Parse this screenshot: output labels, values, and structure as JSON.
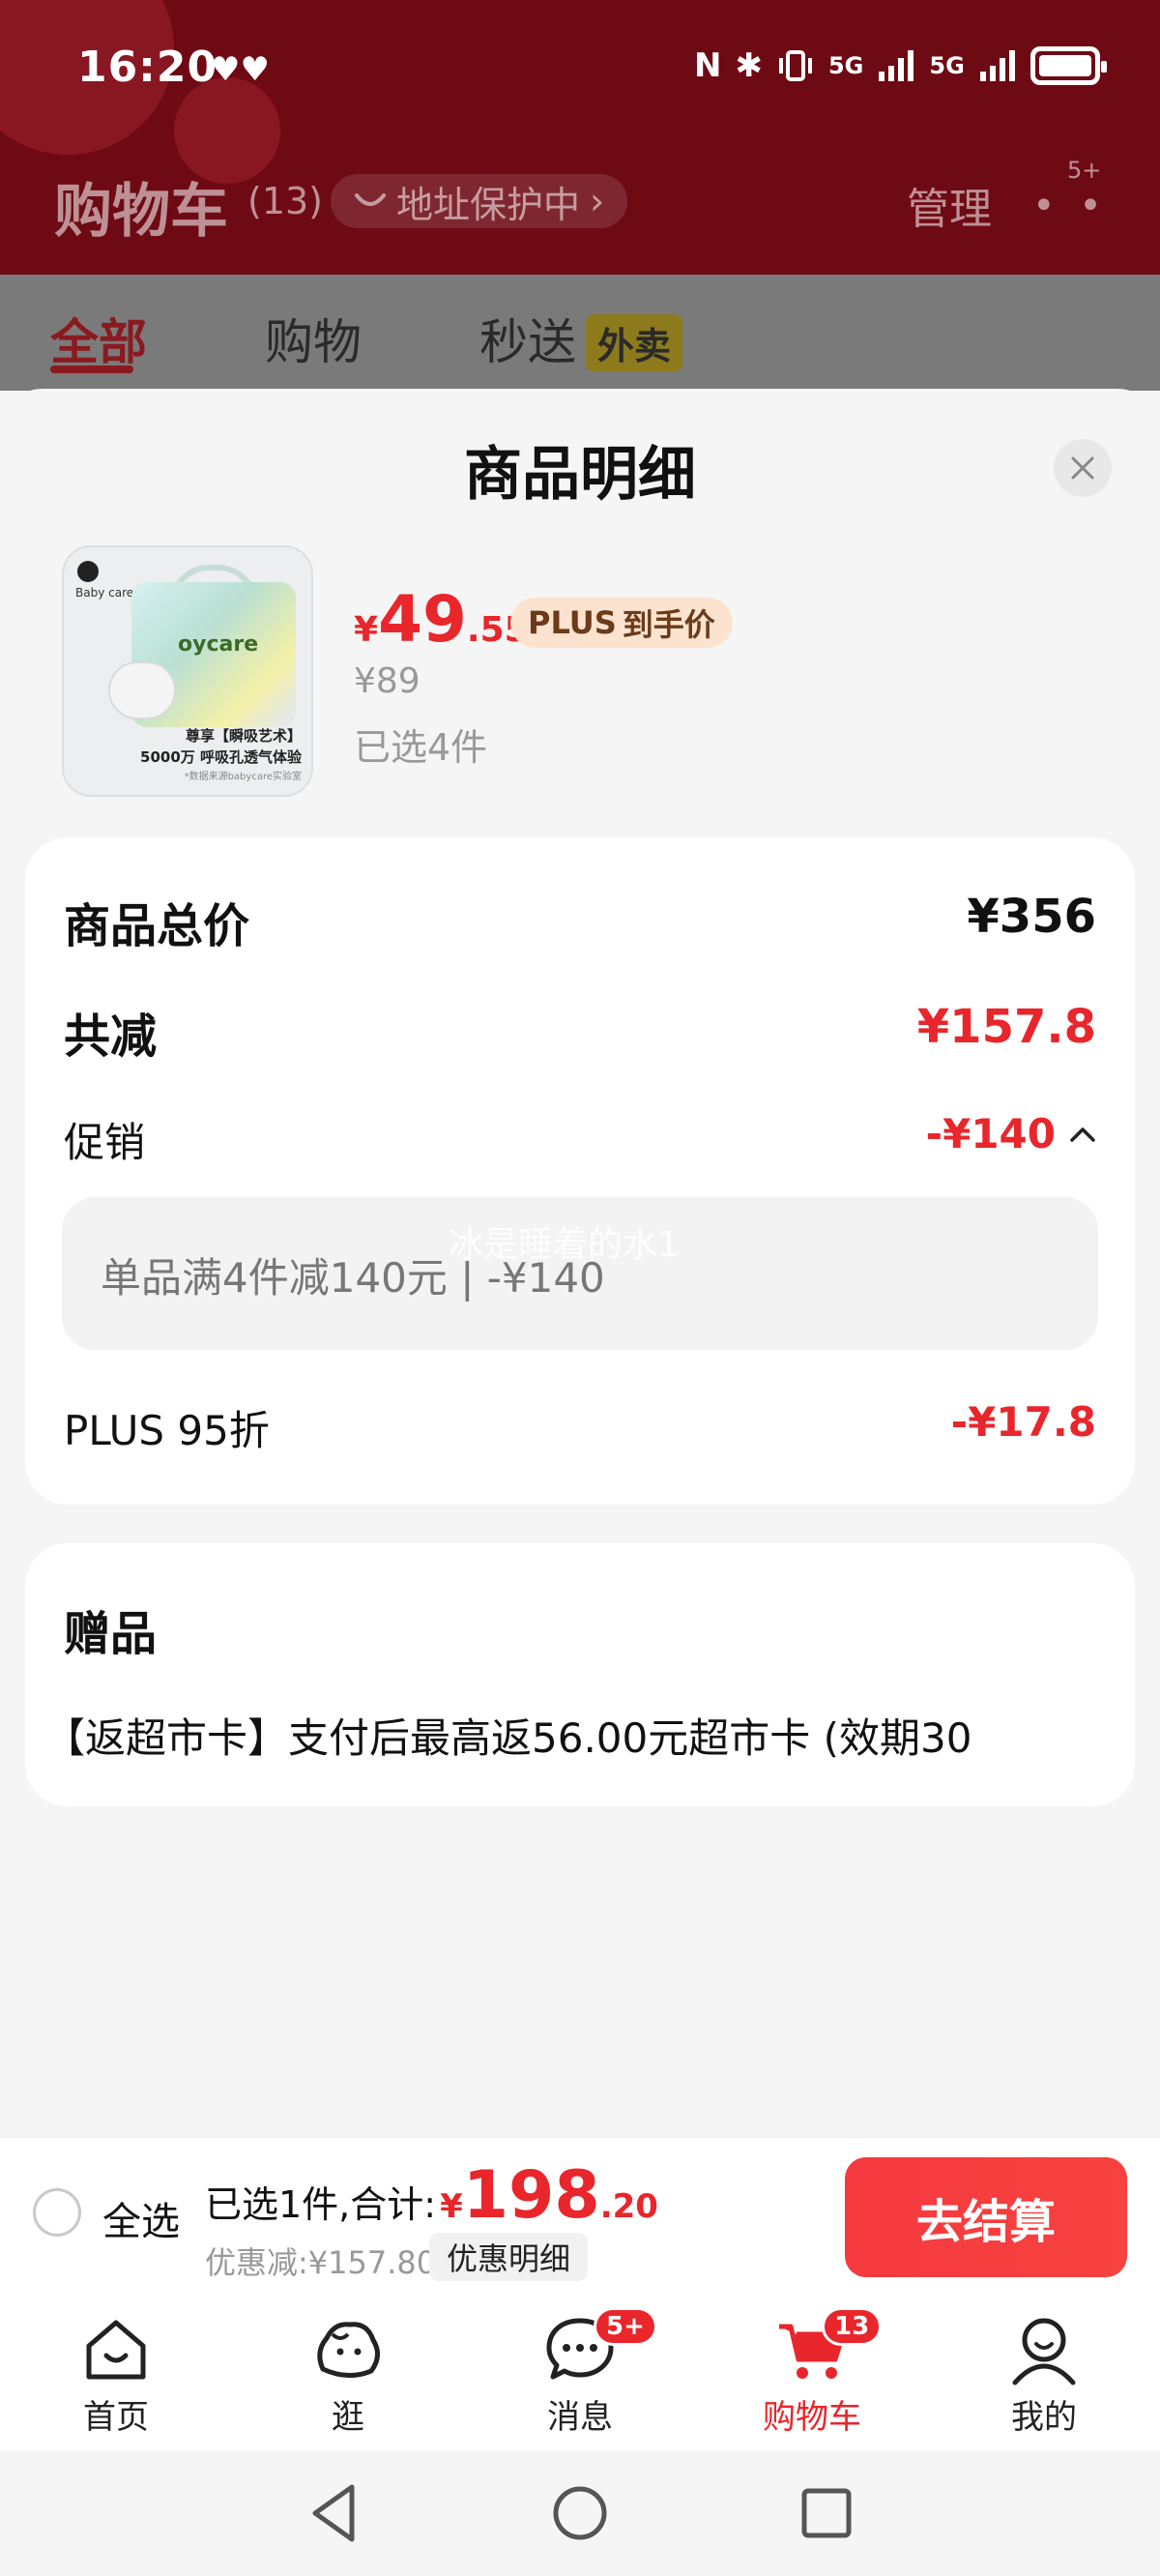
{
  "status_bar": {
    "time": "16:20",
    "notif_glyphs": "♥♥",
    "nfc": "N",
    "bt": "✱",
    "signal1": "5G",
    "signal2": "5G"
  },
  "header": {
    "title": "购物车",
    "count": "(13)",
    "address_label": "地址保护中",
    "manage_label": "管理",
    "more_badge": "5+"
  },
  "tabs": [
    {
      "label": "全部"
    },
    {
      "label": "购物"
    },
    {
      "label": "秒送",
      "tag": "外卖"
    }
  ],
  "sheet": {
    "title": "商品明细",
    "product": {
      "brand": "Baby care",
      "bag_text": "oycare",
      "caption1": "尊享【瞬吸艺术】",
      "caption2": "5000万 呼吸孔透气体验",
      "caption3": "*数据来源babycare实验室",
      "price_symbol": "¥",
      "price_int": "49",
      "price_dec": ".55",
      "plus_label": "PLUS",
      "plus_suffix": "到手价",
      "original_price": "¥89",
      "selected_qty": "已选4件"
    },
    "summary": {
      "total_label": "商品总价",
      "total_value": "¥356",
      "reduce_label": "共减",
      "reduce_value": "¥157.8",
      "promo_label": "促销",
      "promo_value": "-¥140",
      "promo_detail": "单品满4件减140元 | -¥140",
      "watermark": "冰是睡着的水1",
      "plus_discount_label": "PLUS 95折",
      "plus_discount_value": "-¥17.8"
    },
    "gift": {
      "title": "赠品",
      "text": "【返超市卡】支付后最高返56.00元超市卡 (效期30"
    }
  },
  "checkout": {
    "select_all": "全选",
    "selected_total_prefix": "已选1件,合计:",
    "total_symbol": "¥",
    "total_int": "198",
    "total_dec": ".20",
    "discount": "优惠减:¥157.80",
    "discount_detail_button": "优惠明细",
    "checkout_button": "去结算"
  },
  "bottom_nav": [
    {
      "label": "首页",
      "icon": "home-icon"
    },
    {
      "label": "逛",
      "icon": "browse-icon"
    },
    {
      "label": "消息",
      "icon": "message-icon",
      "badge": "5+"
    },
    {
      "label": "购物车",
      "icon": "cart-icon",
      "badge": "13",
      "active": true
    },
    {
      "label": "我的",
      "icon": "profile-icon"
    }
  ],
  "colors": {
    "accent_red": "#e8262b",
    "header_bg": "#6e0a14",
    "plus_tag_bg": "#fbe3cf"
  }
}
